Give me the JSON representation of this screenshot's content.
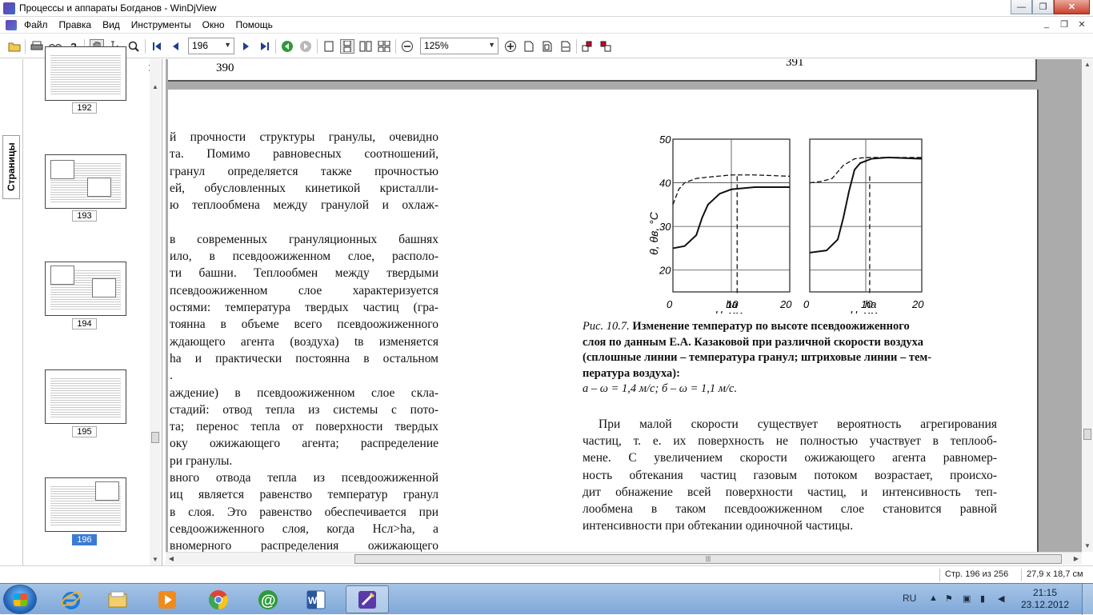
{
  "window": {
    "title": "Процессы и аппараты Богданов - WinDjView",
    "buttons": {
      "minimize": "—",
      "maximize": "❐",
      "close": "✕"
    }
  },
  "menu": {
    "items": [
      "Файл",
      "Правка",
      "Вид",
      "Инструменты",
      "Окно",
      "Помощь"
    ],
    "mdi": {
      "minimize": "_",
      "restore": "❐",
      "close": "✕"
    }
  },
  "toolbar": {
    "page_value": "196",
    "zoom_value": "125%"
  },
  "sidebar": {
    "tab_label": "Страницы",
    "close": "✕",
    "thumbnails": [
      {
        "label": "192",
        "selected": false
      },
      {
        "label": "193",
        "selected": false
      },
      {
        "label": "194",
        "selected": false
      },
      {
        "label": "195",
        "selected": false
      },
      {
        "label": "196",
        "selected": true
      }
    ]
  },
  "document": {
    "prev_page_numbers": {
      "left": "390",
      "right": "391"
    },
    "left_column": [
      "й прочности структуры гранулы, очевидно",
      "та. Помимо равновесных соотношений,",
      "гранул определяется также прочностью",
      "ей, обусловленных кинетикой кристалли-",
      "ю теплообмена между гранулой и охлаж-",
      "",
      "в современных грануляционных башнях",
      "ило, в псевдоожиженном слое, располо-",
      "ти башни. Теплообмен между твердыми",
      "псевдоожиженном слое характеризуется",
      "остями: температура твердых частиц (гра-",
      "тоянна в объеме всего псевдоожиженного",
      "ждающего агента (воздуха) tв изменяется",
      "ha и практически постоянна в остальном",
      ".",
      "аждение) в псевдоожиженном слое скла-",
      "стадий: отвод тепла из системы с пото-",
      "та; перенос тепла от поверхности твердых",
      "оку ожижающего агента; распределение",
      "ри гранулы.",
      "вного отвода тепла из псевдоожиженной",
      "иц является равенство температур гранул",
      "в слоя. Это равенство обеспечивается при",
      "севдоожиженного слоя, когда Hсл>ha, а",
      "вномерного распределения ожижающего"
    ],
    "figure": {
      "y_axis_label": "θ, θв, °C",
      "panel_a": {
        "y_ticks": [
          "50",
          "40",
          "30",
          "20"
        ],
        "x_ticks": [
          "0",
          "10",
          "20"
        ],
        "marker_label": "ha",
        "x_axis_label": "H, мм"
      },
      "panel_b": {
        "x_ticks": [
          "0",
          "10",
          "20"
        ],
        "marker_label": "ha",
        "x_axis_label": "H, мм"
      }
    },
    "caption_lines": [
      {
        "prefix": "Рис. 10.7. ",
        "bold": "Изменение температур по высоте псевдоожиженного"
      },
      {
        "prefix": "",
        "bold": "слоя по данным Е.А. Казаковой при различной скорости воздуха"
      },
      {
        "prefix": "",
        "bold": "(сплошные линии – температура гранул; штриховые линии – тем-"
      },
      {
        "prefix": "",
        "bold": "пература воздуха):"
      },
      {
        "prefix": "а – ω = 1,4 м/с; б – ω = 1,1 м/с.",
        "bold": ""
      }
    ],
    "right_paragraph": [
      "При малой скорости существует вероятность агрегирования",
      "частиц, т. е. их поверхность не полностью участвует в теплооб-",
      "мене. С увеличением скорости ожижающего агента равномер-",
      "ность обтекания частиц газовым потоком возрастает, происхо-",
      "дит обнажение всей поверхности частиц, и интенсивность теп-",
      "лообмена в таком псевдоожиженном слое становится равной",
      "интенсивности при обтекании одиночной частицы."
    ]
  },
  "statusbar": {
    "page_info": "Стр. 196 из 256",
    "page_size": "27,9 x 18,7 см"
  },
  "taskbar": {
    "language": "RU",
    "time": "21:15",
    "date": "23.12.2012"
  },
  "chart_data": [
    {
      "type": "line",
      "title": "а",
      "xlabel": "H, мм",
      "ylabel": "θ, θв, °C",
      "xlim": [
        0,
        20
      ],
      "ylim": [
        15,
        50
      ],
      "series": [
        {
          "name": "температура гранул",
          "x": [
            0,
            2,
            4,
            5,
            6,
            8,
            10,
            14,
            20
          ],
          "values": [
            25,
            25.5,
            28,
            32,
            35,
            37.5,
            38.5,
            39,
            39
          ]
        },
        {
          "name": "температура воздуха",
          "x": [
            0,
            1,
            2,
            4,
            6,
            10,
            14,
            20
          ],
          "values": [
            35,
            38.5,
            40,
            41,
            41.3,
            41.8,
            41.8,
            41.5
          ]
        }
      ]
    },
    {
      "type": "line",
      "title": "б",
      "xlabel": "H, мм",
      "ylabel": "θ, θв, °C",
      "xlim": [
        0,
        20
      ],
      "ylim": [
        15,
        50
      ],
      "series": [
        {
          "name": "температура гранул",
          "x": [
            0,
            3,
            5,
            6,
            7,
            8,
            9,
            11,
            14,
            20
          ],
          "values": [
            24,
            24.5,
            27,
            32,
            38,
            43,
            44.5,
            45.5,
            45.8,
            45.5
          ]
        },
        {
          "name": "температура воздуха",
          "x": [
            0,
            2,
            4,
            6,
            8,
            10,
            14,
            20
          ],
          "values": [
            40,
            40.3,
            41,
            44,
            45.5,
            45.8,
            45.8,
            45.8
          ]
        }
      ]
    }
  ]
}
